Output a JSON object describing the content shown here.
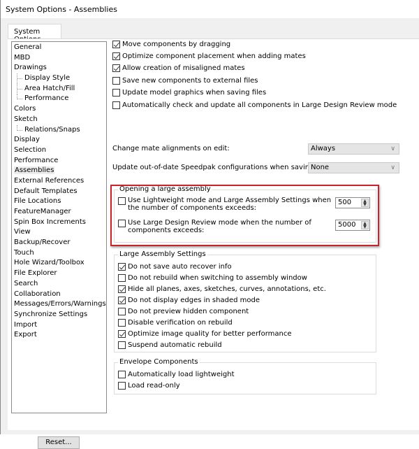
{
  "window": {
    "title": "System Options - Assemblies"
  },
  "tabs": [
    {
      "label": "System Options",
      "active": true
    }
  ],
  "tree": {
    "items": [
      {
        "label": "General",
        "level": 0
      },
      {
        "label": "MBD",
        "level": 0
      },
      {
        "label": "Drawings",
        "level": 0
      },
      {
        "label": "Display Style",
        "level": 1
      },
      {
        "label": "Area Hatch/Fill",
        "level": 1
      },
      {
        "label": "Performance",
        "level": 1
      },
      {
        "label": "Colors",
        "level": 0
      },
      {
        "label": "Sketch",
        "level": 0
      },
      {
        "label": "Relations/Snaps",
        "level": 1
      },
      {
        "label": "Display",
        "level": 0
      },
      {
        "label": "Selection",
        "level": 0
      },
      {
        "label": "Performance",
        "level": 0
      },
      {
        "label": "Assemblies",
        "level": 0,
        "selected": true
      },
      {
        "label": "External References",
        "level": 0
      },
      {
        "label": "Default Templates",
        "level": 0
      },
      {
        "label": "File Locations",
        "level": 0
      },
      {
        "label": "FeatureManager",
        "level": 0
      },
      {
        "label": "Spin Box Increments",
        "level": 0
      },
      {
        "label": "View",
        "level": 0
      },
      {
        "label": "Backup/Recover",
        "level": 0
      },
      {
        "label": "Touch",
        "level": 0
      },
      {
        "label": "Hole Wizard/Toolbox",
        "level": 0
      },
      {
        "label": "File Explorer",
        "level": 0
      },
      {
        "label": "Search",
        "level": 0
      },
      {
        "label": "Collaboration",
        "level": 0
      },
      {
        "label": "Messages/Errors/Warnings",
        "level": 0
      },
      {
        "label": "Synchronize Settings",
        "level": 0
      },
      {
        "label": "Import",
        "level": 0
      },
      {
        "label": "Export",
        "level": 0
      }
    ],
    "reset_label": "Reset..."
  },
  "options": {
    "checkboxes": [
      {
        "label": "Move components by dragging",
        "checked": true
      },
      {
        "label": "Optimize component placement when adding mates",
        "checked": true
      },
      {
        "label": "Allow creation of misaligned mates",
        "checked": true
      },
      {
        "label": "Save new components to external files",
        "checked": false
      },
      {
        "label": "Update model graphics when saving files",
        "checked": false
      },
      {
        "label": "Automatically check and update all components in Large Design Review mode",
        "checked": false
      }
    ],
    "mate_alignment": {
      "label": "Change mate alignments on edit:",
      "value": "Always"
    },
    "speedpak": {
      "label": "Update out-of-date Speedpak configurations when saving files:",
      "value": "None"
    }
  },
  "large_assembly_open": {
    "title": "Opening a large assembly",
    "lightweight": {
      "label_line1": "Use Lightweight mode and Large Assembly Settings when",
      "label_line2": "the number of components exceeds:",
      "checked": false,
      "value": "500"
    },
    "ldr": {
      "label_line1": "Use Large Design Review mode when the number of",
      "label_line2": "components exceeds:",
      "checked": false,
      "value": "5000"
    },
    "highlight_color": "#c8232c"
  },
  "large_assembly_settings": {
    "title": "Large Assembly Settings",
    "items": [
      {
        "label": "Do not save auto recover info",
        "checked": true
      },
      {
        "label": "Do not rebuild when switching to assembly window",
        "checked": false
      },
      {
        "label": "Hide all planes, axes, sketches, curves, annotations, etc.",
        "checked": true
      },
      {
        "label": "Do not display edges in shaded mode",
        "checked": true
      },
      {
        "label": "Do not preview hidden component",
        "checked": false
      },
      {
        "label": "Disable verification on rebuild",
        "checked": false
      },
      {
        "label": "Optimize image quality for better performance",
        "checked": true
      },
      {
        "label": "Suspend automatic rebuild",
        "checked": false
      }
    ]
  },
  "envelope": {
    "title": "Envelope Components",
    "items": [
      {
        "label": "Automatically load lightweight",
        "checked": false
      },
      {
        "label": "Load read-only",
        "checked": false
      }
    ]
  }
}
